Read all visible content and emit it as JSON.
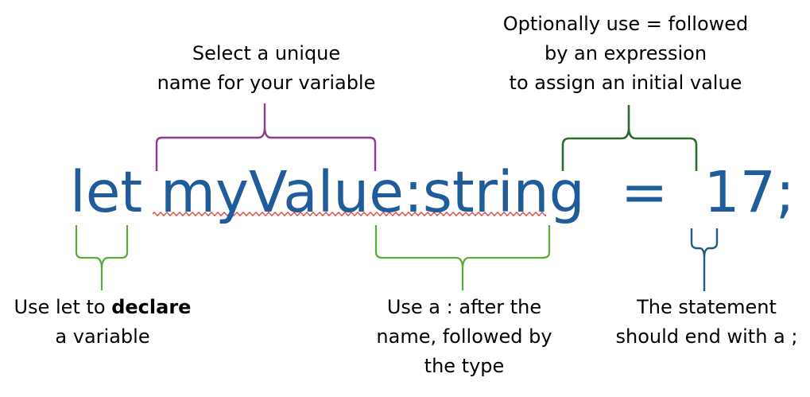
{
  "code": {
    "keyword": "let",
    "identifier": "myValue",
    "colon": ":",
    "type": "string",
    "equals": "=",
    "value": "17",
    "semicolon": ";"
  },
  "annotations": {
    "let": {
      "line1_pre": "Use let to ",
      "line1_bold": "declare",
      "line2": "a variable"
    },
    "name": {
      "line1": "Select a unique",
      "line2": "name for your variable"
    },
    "type": {
      "line1": "Use a : after the",
      "line2": "name, followed by",
      "line3": "the type"
    },
    "assign": {
      "line1": "Optionally use = followed",
      "line2": "by an expression",
      "line3": "to assign an initial value"
    },
    "end": {
      "line1": "The statement",
      "line2": "should end with a ;"
    }
  },
  "colors": {
    "code_text": "#1f5c99",
    "brace_let": "#5aab3c",
    "brace_name": "#8e3a8e",
    "brace_type": "#5aab3c",
    "brace_assign": "#2e6b2e",
    "brace_end": "#1f5c80",
    "spellcheck": "#e0302a"
  }
}
